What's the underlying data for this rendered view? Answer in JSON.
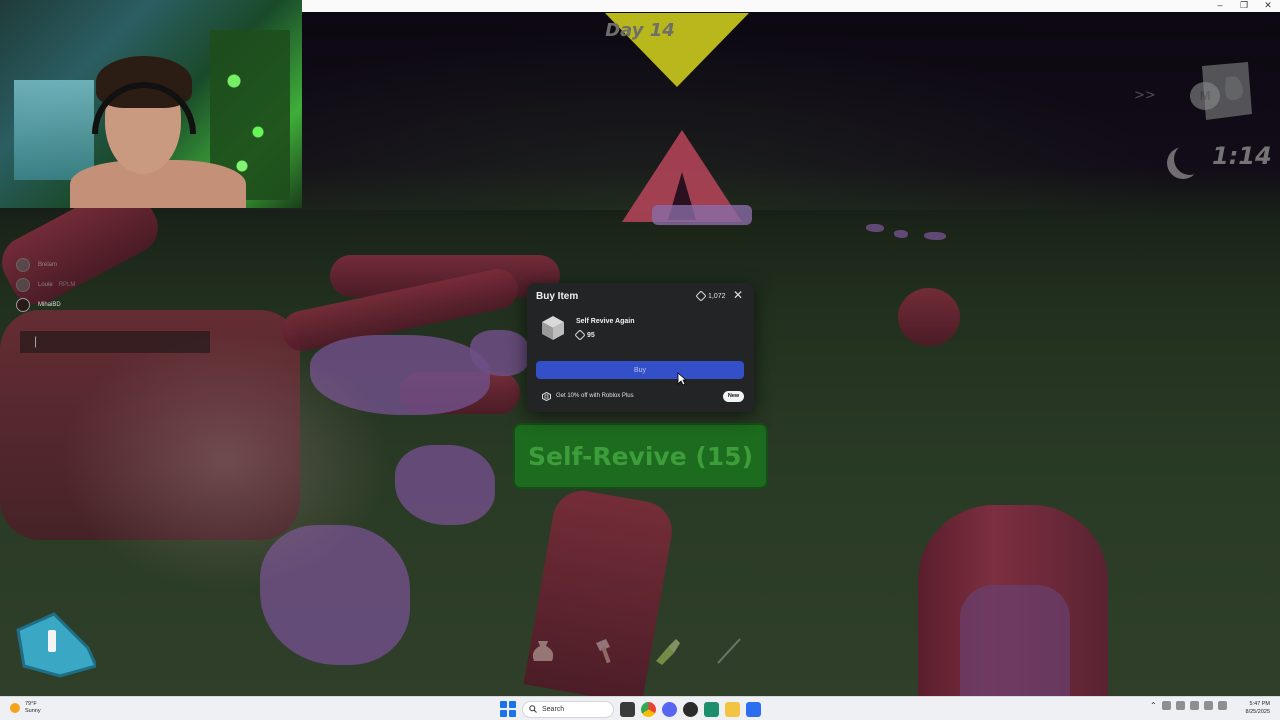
{
  "hud": {
    "day_label": "Day 14",
    "time_remaining": "1:14",
    "map_key": "M",
    "expand_glyph": ">>",
    "colors": {
      "day_flag": "#b8b81c",
      "revive_button": "#1c6b1e"
    }
  },
  "players": [
    {
      "name": "Brelam",
      "tag": ""
    },
    {
      "name": "Louie",
      "tag": "RPLM"
    },
    {
      "name": "MihaiBD",
      "tag": ""
    }
  ],
  "revive_button": {
    "label": "Self-Revive (15)"
  },
  "buy_modal": {
    "title": "Buy Item",
    "balance": "1,072",
    "item_name": "Self Revive Again",
    "item_price": "95",
    "buy_label": "Buy",
    "promo_text": "Get 10% off with Roblox Plus",
    "promo_badge": "New",
    "colors": {
      "panel": "#232426",
      "buy_button": "#3450c9"
    }
  },
  "taskbar": {
    "weather_temp": "79°F",
    "weather_desc": "Sunny",
    "search_placeholder": "Search",
    "clock_time": "5:47 PM",
    "clock_date": "8/25/2025"
  },
  "window_controls": {
    "minimize": "–",
    "restore": "❐",
    "close": "✕"
  }
}
